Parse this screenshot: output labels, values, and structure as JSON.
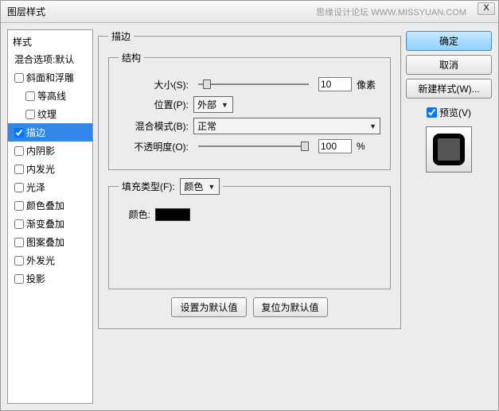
{
  "title": "图层样式",
  "watermark": "思缘设计论坛  WWW.MISSYUAN.COM",
  "close_x": "X",
  "left": {
    "header": "样式",
    "blend_default": "混合选项:默认",
    "items": [
      {
        "label": "斜面和浮雕",
        "checked": false,
        "indent": false
      },
      {
        "label": "等高线",
        "checked": false,
        "indent": true
      },
      {
        "label": "纹理",
        "checked": false,
        "indent": true
      },
      {
        "label": "描边",
        "checked": true,
        "indent": false,
        "selected": true
      },
      {
        "label": "内阴影",
        "checked": false,
        "indent": false
      },
      {
        "label": "内发光",
        "checked": false,
        "indent": false
      },
      {
        "label": "光泽",
        "checked": false,
        "indent": false
      },
      {
        "label": "颜色叠加",
        "checked": false,
        "indent": false
      },
      {
        "label": "渐变叠加",
        "checked": false,
        "indent": false
      },
      {
        "label": "图案叠加",
        "checked": false,
        "indent": false
      },
      {
        "label": "外发光",
        "checked": false,
        "indent": false
      },
      {
        "label": "投影",
        "checked": false,
        "indent": false
      }
    ]
  },
  "middle": {
    "group_title": "描边",
    "structure_title": "结构",
    "size_label": "大小(S):",
    "size_value": "10",
    "size_unit": "像素",
    "position_label": "位置(P):",
    "position_value": "外部",
    "blend_label": "混合模式(B):",
    "blend_value": "正常",
    "opacity_label": "不透明度(O):",
    "opacity_value": "100",
    "opacity_unit": "%",
    "fill_title": "填充类型(F):",
    "fill_value": "颜色",
    "color_label": "颜色:",
    "color_hex": "#000000",
    "set_default": "设置为默认值",
    "reset_default": "复位为默认值"
  },
  "right": {
    "ok": "确定",
    "cancel": "取消",
    "new_style": "新建样式(W)...",
    "preview_label": "预览(V)",
    "preview_checked": true
  }
}
